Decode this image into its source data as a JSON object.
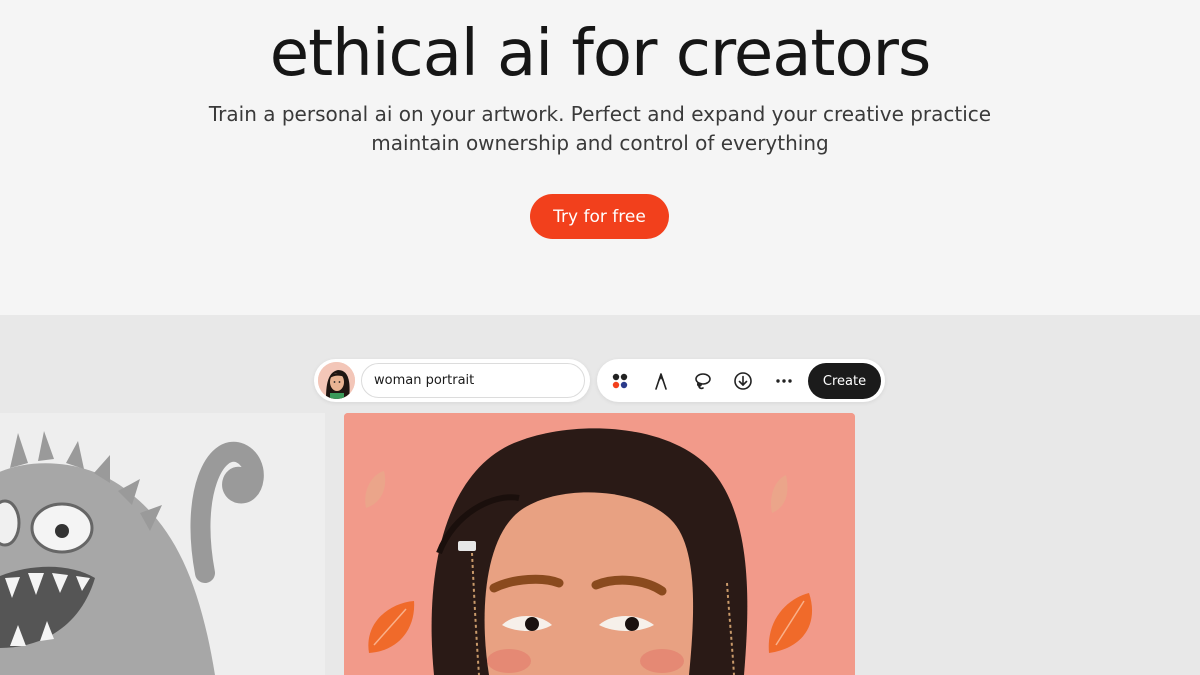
{
  "hero": {
    "title": "ethical ai for creators",
    "subtitle_line1": "Train a personal ai on your artwork. Perfect and expand your creative practice",
    "subtitle_line2": "maintain ownership and control of everything",
    "cta_label": "Try for free"
  },
  "toolbar": {
    "prompt_value": "woman portrait",
    "tools": [
      "palette-icon",
      "pen-icon",
      "lasso-icon",
      "download-icon",
      "more-icon"
    ],
    "create_label": "Create"
  },
  "colors": {
    "accent": "#f2401c",
    "dark_button": "#1b1b1b",
    "artwork_background": "#f29a8a"
  }
}
